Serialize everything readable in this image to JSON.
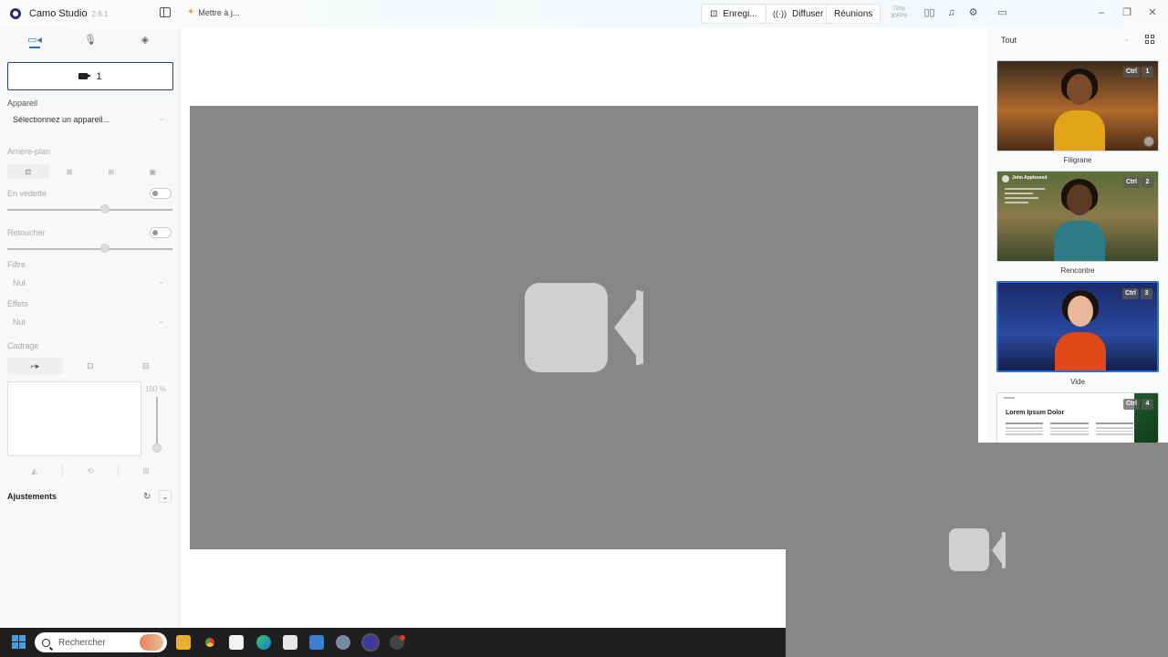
{
  "titlebar": {
    "app_name": "Camo Studio",
    "version": "2.6.1",
    "update_label": "Mettre à j...",
    "record_label": "Enregi...",
    "broadcast_label": "Diffuser",
    "meetings_label": "Réunions",
    "resolution": "720p",
    "fps": "30FPS"
  },
  "left_panel": {
    "source_number": "1",
    "device_label": "Appareil",
    "device_placeholder": "Sélectionnez un appareil...",
    "background_label": "Arrière-plan",
    "featured_label": "En vedette",
    "retouch_label": "Retoucher",
    "filter_label": "Filtre",
    "filter_value": "Nul",
    "effects_label": "Effets",
    "effects_value": "Nul",
    "framing_label": "Cadrage",
    "zoom_value": "100 %",
    "adjustments_label": "Ajustements",
    "featured_level": 0.6,
    "retouch_level": 0.6,
    "zoom_level": 1.0
  },
  "right_panel": {
    "filter_value": "Tout",
    "scenes": [
      {
        "label": "Filigrane",
        "shortcut": "Ctrl",
        "number": "1"
      },
      {
        "label": "Rencontre",
        "shortcut": "Ctrl",
        "number": "2",
        "overlay_name": "John Appleseed"
      },
      {
        "label": "Vide",
        "shortcut": "Ctrl",
        "number": "3"
      },
      {
        "label": "",
        "shortcut": "Ctrl",
        "number": "4",
        "doc_title": "Lorem Ipsum Dolor"
      }
    ]
  },
  "taskbar": {
    "search_label": "Rechercher"
  },
  "colors": {
    "accent": "#2f6fd1",
    "preview_bg": "#878787",
    "camera_glyph": "#d0d0d0"
  }
}
